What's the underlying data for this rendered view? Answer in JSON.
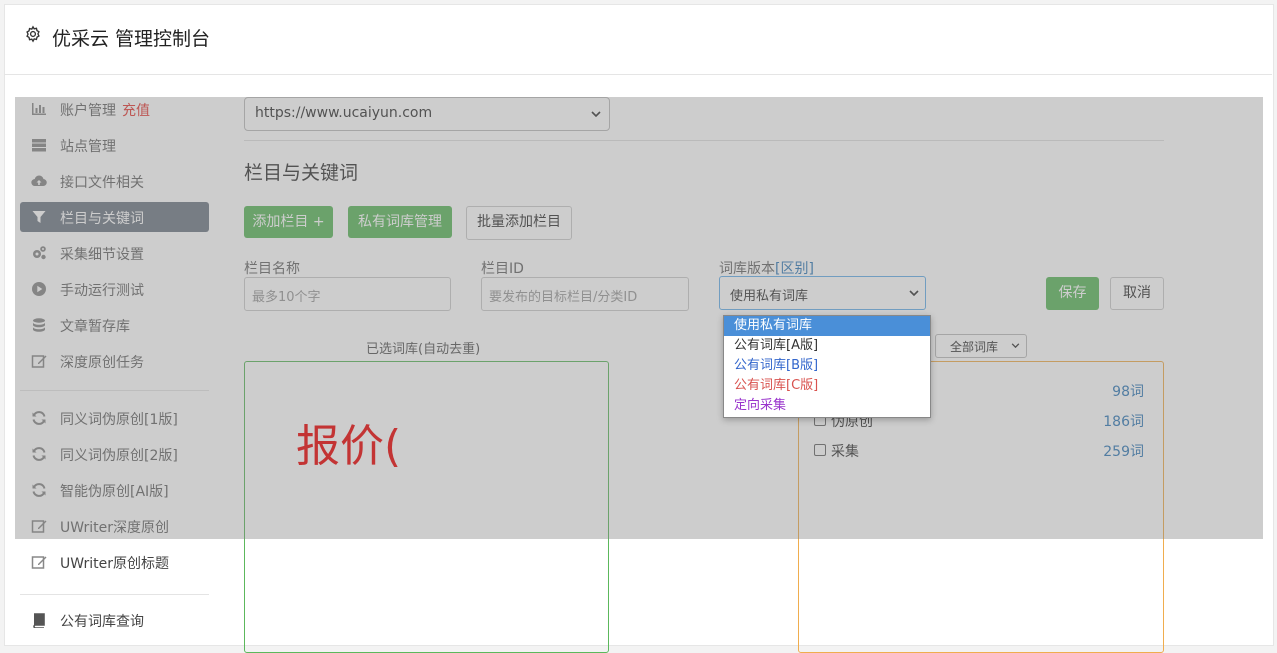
{
  "app": {
    "title": "优采云 管理控制台",
    "icon": "gear-icon"
  },
  "sidebar": {
    "items": [
      {
        "label": "账户管理",
        "badge": "充值",
        "icon": "bar-chart-icon"
      },
      {
        "label": "站点管理",
        "icon": "server-icon"
      },
      {
        "label": "接口文件相关",
        "icon": "cloud-upload-icon"
      },
      {
        "label": "栏目与关键词",
        "icon": "filter-icon",
        "active": true
      },
      {
        "label": "采集细节设置",
        "icon": "cogs-icon"
      },
      {
        "label": "手动运行测试",
        "icon": "play-circle-icon"
      },
      {
        "label": "文章暂存库",
        "icon": "database-icon"
      },
      {
        "label": "深度原创任务",
        "icon": "edit-icon"
      },
      {
        "label": "同义词伪原创[1版]",
        "icon": "refresh-icon"
      },
      {
        "label": "同义词伪原创[2版]",
        "icon": "refresh-icon"
      },
      {
        "label": "智能伪原创[AI版]",
        "icon": "refresh-icon"
      },
      {
        "label": "UWriter深度原创",
        "icon": "edit-icon"
      },
      {
        "label": "UWriter原创标题",
        "icon": "edit-icon"
      },
      {
        "label": "公有词库查询",
        "icon": "book-icon"
      }
    ]
  },
  "main": {
    "site_select": {
      "value": "https://www.ucaiyun.com"
    },
    "section_title": "栏目与关键词",
    "buttons": {
      "add_column": "添加栏目 +",
      "private_lib": "私有词库管理",
      "batch_add": "批量添加栏目"
    },
    "form": {
      "name_label": "栏目名称",
      "name_placeholder": "最多10个字",
      "id_label": "栏目ID",
      "id_placeholder": "要发布的目标栏目/分类ID",
      "version_label": "词库版本",
      "version_link": "[区别]",
      "version_value": "使用私有词库",
      "save": "保存",
      "cancel": "取消"
    },
    "selected_panel": {
      "title": "已选词库(自动去重)",
      "overlay_text": "报价("
    },
    "library_panel": {
      "filter_value": "全部词库",
      "rows": [
        {
          "name": "",
          "count": "98词"
        },
        {
          "name": "伪原创",
          "count": "186词"
        },
        {
          "name": "采集",
          "count": "259词"
        }
      ]
    },
    "version_dropdown": {
      "options": [
        {
          "label": "使用私有词库",
          "color": "#ffffff",
          "selected": true
        },
        {
          "label": "公有词库[A版]",
          "color": "#333333"
        },
        {
          "label": "公有词库[B版]",
          "color": "#3366cc"
        },
        {
          "label": "公有词库[C版]",
          "color": "#d9534f"
        },
        {
          "label": "定向采集",
          "color": "#9933cc"
        }
      ]
    }
  },
  "colors": {
    "primary_green": "#5cb85c",
    "active_nav": "#717a86",
    "link": "#337ab7",
    "badge_red": "#e53935"
  }
}
